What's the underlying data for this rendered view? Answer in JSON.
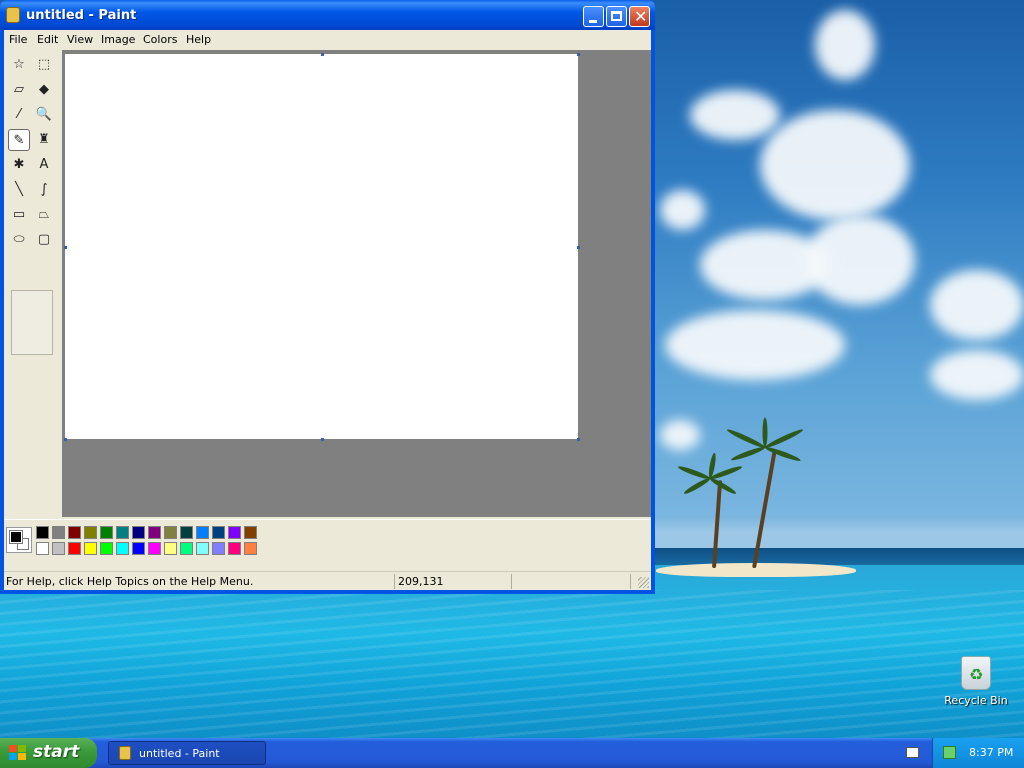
{
  "window": {
    "title": "untitled - Paint",
    "menu": [
      "File",
      "Edit",
      "View",
      "Image",
      "Colors",
      "Help"
    ]
  },
  "toolbox": {
    "tools": [
      {
        "name": "free-form-select-tool",
        "glyph": "☆"
      },
      {
        "name": "select-tool",
        "glyph": "⬚"
      },
      {
        "name": "eraser-tool",
        "glyph": "▱"
      },
      {
        "name": "fill-tool",
        "glyph": "◆"
      },
      {
        "name": "pick-color-tool",
        "glyph": "⁄"
      },
      {
        "name": "magnifier-tool",
        "glyph": "🔍"
      },
      {
        "name": "pencil-tool",
        "glyph": "✎"
      },
      {
        "name": "brush-tool",
        "glyph": "♜"
      },
      {
        "name": "airbrush-tool",
        "glyph": "✱"
      },
      {
        "name": "text-tool",
        "glyph": "A"
      },
      {
        "name": "line-tool",
        "glyph": "╲"
      },
      {
        "name": "curve-tool",
        "glyph": "∫"
      },
      {
        "name": "rectangle-tool",
        "glyph": "▭"
      },
      {
        "name": "polygon-tool",
        "glyph": "⏢"
      },
      {
        "name": "ellipse-tool",
        "glyph": "⬭"
      },
      {
        "name": "rounded-rectangle-tool",
        "glyph": "▢"
      }
    ],
    "active": "pencil-tool"
  },
  "palette": {
    "foreground": "#000000",
    "background": "#ffffff",
    "colors_top": [
      "#000000",
      "#808080",
      "#800000",
      "#808000",
      "#008000",
      "#008080",
      "#000080",
      "#800080",
      "#808040",
      "#004040",
      "#0080ff",
      "#004080",
      "#8000ff",
      "#804000"
    ],
    "colors_bottom": [
      "#ffffff",
      "#c0c0c0",
      "#ff0000",
      "#ffff00",
      "#00ff00",
      "#00ffff",
      "#0000ff",
      "#ff00ff",
      "#ffff80",
      "#00ff80",
      "#80ffff",
      "#8080ff",
      "#ff0080",
      "#ff8040"
    ]
  },
  "status": {
    "help": "For Help, click Help Topics on the Help Menu.",
    "coords": "209,131"
  },
  "desktop": {
    "recycle_bin": "Recycle Bin"
  },
  "taskbar": {
    "start": "start",
    "task": "untitled - Paint",
    "clock": "8:37 PM"
  }
}
